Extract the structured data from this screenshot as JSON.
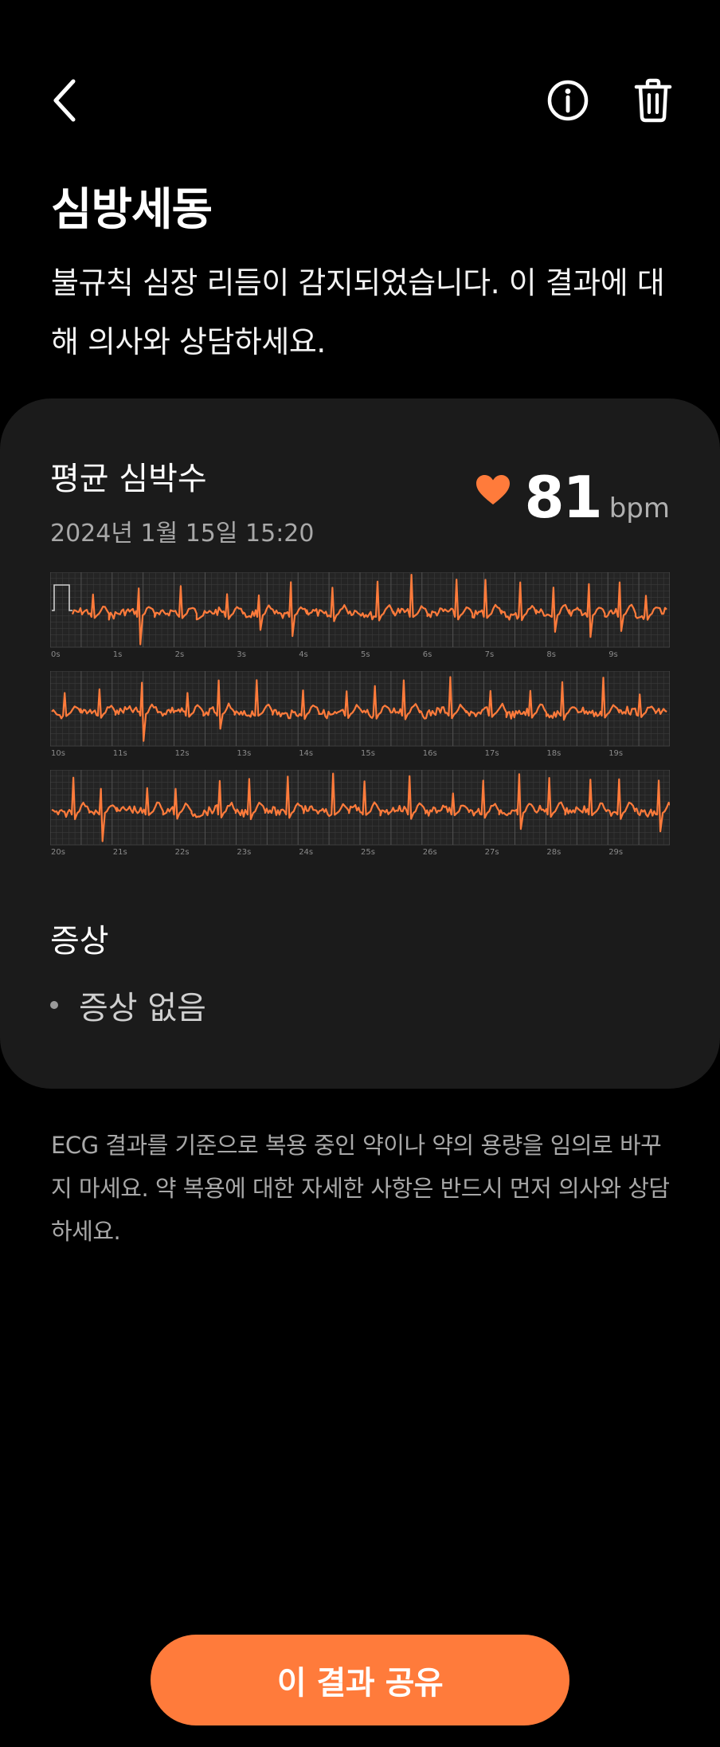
{
  "header": {
    "back_icon": "chevron-left-icon",
    "info_icon": "info-icon",
    "delete_icon": "trash-icon"
  },
  "title": "심방세동",
  "subtitle": "불규칙 심장 리듬이 감지되었습니다. 이 결과에 대해 의사와 상담하세요.",
  "card": {
    "label": "평균 심박수",
    "date": "2024년 1월 15일 15:20",
    "heart_rate": "81",
    "unit": "bpm",
    "heart_color": "#ff7b3b",
    "ecg": {
      "strips": [
        {
          "ticks": [
            "0s",
            "1s",
            "2s",
            "3s",
            "4s",
            "5s",
            "6s",
            "7s",
            "8s",
            "9s"
          ]
        },
        {
          "ticks": [
            "10s",
            "11s",
            "12s",
            "13s",
            "14s",
            "15s",
            "16s",
            "17s",
            "18s",
            "19s"
          ]
        },
        {
          "ticks": [
            "20s",
            "21s",
            "22s",
            "23s",
            "24s",
            "25s",
            "26s",
            "27s",
            "28s",
            "29s"
          ]
        }
      ],
      "line_color": "#ff7b3b",
      "grid_color": "#3a3a3a"
    },
    "symptoms_title": "증상",
    "symptoms": [
      "증상 없음"
    ]
  },
  "disclaimer": "ECG 결과를 기준으로 복용 중인 약이나 약의 용량을 임의로 바꾸지 마세요. 약 복용에 대한 자세한 사항은 반드시 먼저 의사와 상담하세요.",
  "share_button": "이 결과 공유",
  "accent_color": "#ff7b3b"
}
